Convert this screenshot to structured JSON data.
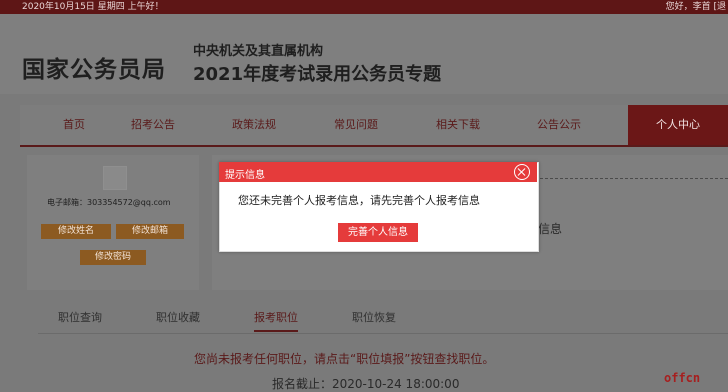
{
  "topbar": {
    "date": "2020年10月15日",
    "weekday": "星期四",
    "greeting": "上午好！",
    "user_greeting": "您好，李首",
    "exit": "[退"
  },
  "header": {
    "logo": "国家公务员局",
    "subtitle_1": "中央机关及其直属机构",
    "subtitle_2": "2021年度考试录用公务员专题"
  },
  "nav": {
    "items": [
      "首页",
      "招考公告",
      "政策法规",
      "常见问题",
      "相关下载",
      "公告公示",
      "个人中心"
    ]
  },
  "profile": {
    "email": "电子邮箱：303354572@qq.com",
    "buttons": [
      "修改姓名",
      "修改邮箱",
      "修改密码"
    ]
  },
  "panel": {
    "info_tail": "信息"
  },
  "tabs": [
    "职位查询",
    "职位收藏",
    "报考职位",
    "职位恢复"
  ],
  "main": {
    "notice": "您尚未报考任何职位，请点击“职位填报”按钮查找职位。",
    "deadline": "报名截止：2020-10-24 18:00:00",
    "watermark": "offcn"
  },
  "modal": {
    "title": "提示信息",
    "message": "您还未完善个人报考信息，请先完善个人报考信息",
    "button": "完善个人信息"
  }
}
